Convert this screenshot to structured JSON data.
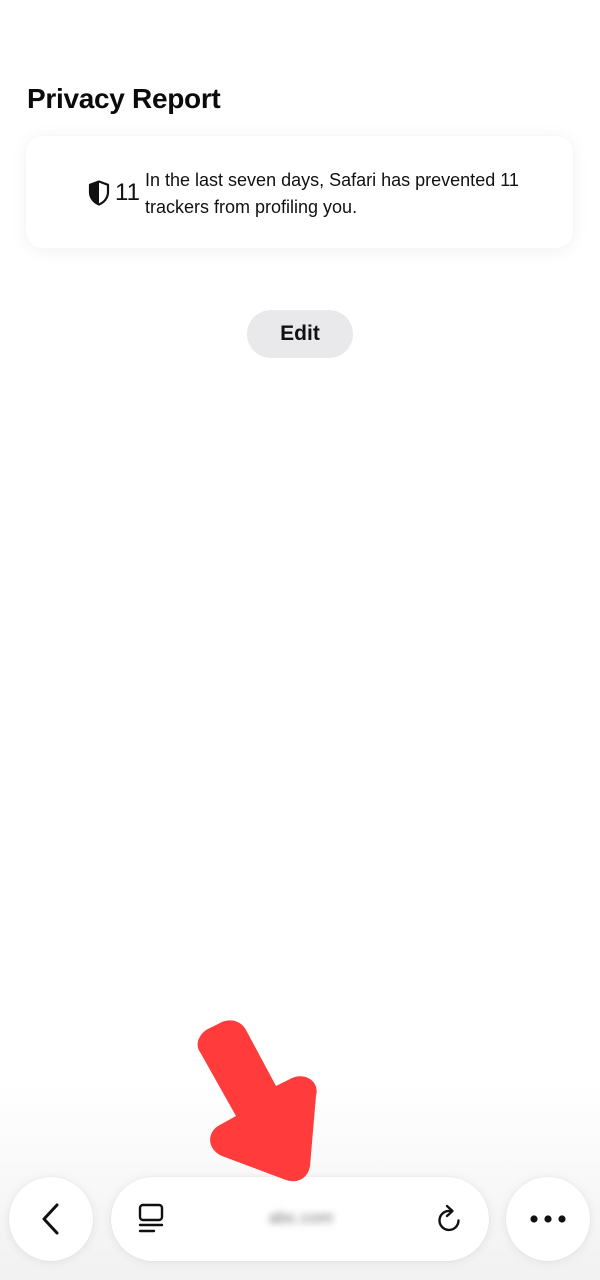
{
  "privacy_report": {
    "title": "Privacy Report",
    "tracker_count": "11",
    "summary": "In the last seven days, Safari has prevented 11 trackers from profiling you."
  },
  "edit_button": {
    "label": "Edit"
  },
  "toolbar": {
    "address_text": "abc.com",
    "icons": {
      "back": "chevron-left-icon",
      "tabs": "tab-overview-icon",
      "reload": "reload-icon",
      "more": "more-dots-icon"
    }
  },
  "colors": {
    "annotation_arrow": "#ff3b3b",
    "edit_button_bg": "#e9e9eb"
  }
}
